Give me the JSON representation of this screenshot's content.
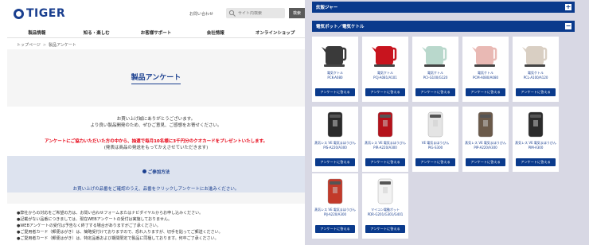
{
  "header": {
    "logo_text": "TIGER",
    "inquiry_label": "お問い合わせ",
    "search_placeholder": "サイト内検索",
    "search_button": "検索"
  },
  "nav": [
    "製品情報",
    "知る・楽しむ",
    "お客様サポート",
    "会社情報",
    "オンラインショップ"
  ],
  "breadcrumb": {
    "home": "トップページ",
    "current": "製品アンケート"
  },
  "page_title": "製品アンケート",
  "intro": {
    "line1": "お買い上げ誠にありがとうございます。",
    "line2": "より良い製品開発のため、ぜひご意見、ご感想をお寄せください。",
    "red": "アンケートにご協力いただいた方の中から、抽選で毎月10名様に3千円分のクオカードをプレゼントいたします。",
    "note": "(発表は商品の発送をもってかえさせていただきます)"
  },
  "howto": {
    "title": "ご参加方法",
    "text": "お買い上げの品番をご確認のうえ、品番をクリックしアンケートにお進みください。"
  },
  "notes": [
    "●弊社からの対応をご希望の方は、お問い合わせフォームまたはナビダイヤルからお申し込みください。",
    "●記載がない品番につきましては、現在WEBアンケートの受付は実施しておりません。",
    "●WEBアンケートの受付は予告なく終了する場合がありますがご了承ください。",
    "●ご愛用者カード（郵便はがき）は、簡略受付けておりますので、恐れ入りますが、切手を貼ってご郵送ください。",
    "●ご愛用者カード（郵便はがき）は、特定品番および期間限定で製品に同梱しております。何卒ご了承ください。"
  ],
  "right": {
    "collapsed_section": "炊飯ジャー",
    "expanded_section": "電気ポット／電気ケトル",
    "button_label": "アンケートに答える",
    "products": [
      {
        "type": "電気ケトル",
        "model": "PCK-A080",
        "color": "#3a3a3a"
      },
      {
        "type": "電気ケトル",
        "model": "PCJ-A081/A101",
        "color": "#c8141e"
      },
      {
        "type": "電気ケトル",
        "model": "PCI-G100/G120",
        "color": "#b9d8cc"
      },
      {
        "type": "電気ケトル",
        "model": "PCM-A080/A080",
        "color": "#e9b9b4"
      },
      {
        "type": "電気ケトル",
        "model": "PCL-A100/A120",
        "color": "#d9cfc3"
      },
      {
        "type": "蒸気レス VE 電気まほうびん",
        "model": "PIS-A220/A300",
        "color": "#2a2a2a"
      },
      {
        "type": "蒸気レス VE 電気まほうびん",
        "model": "PIR-A220/A300",
        "color": "#b5121b"
      },
      {
        "type": "VE 電気まほうびん",
        "model": "PIG-S300",
        "color": "#e4e4e4"
      },
      {
        "type": "蒸気レス VE 電気まほうびん",
        "model": "PIP-A220/A300",
        "color": "#6b5a4a"
      },
      {
        "type": "蒸気レス VE 電気まほうびん",
        "model": "PIM-A300",
        "color": "#2b2b2b"
      },
      {
        "type": "蒸気レス VE 電気まほうびん",
        "model": "PIJ-A220/A300",
        "color": "#c23a2a"
      },
      {
        "type": "マイコン電動ポット",
        "model": "PDR-G201/G301/G401",
        "color": "#f2f2f2"
      }
    ]
  }
}
